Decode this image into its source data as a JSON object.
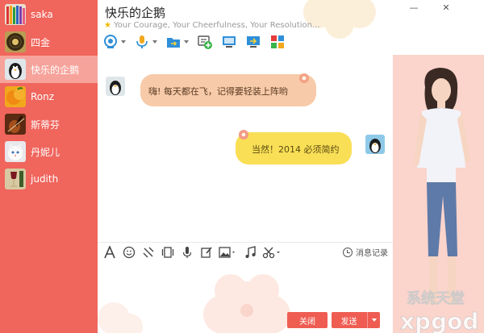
{
  "contacts": [
    {
      "name": "saka",
      "icon": "pencils-avatar",
      "active": false
    },
    {
      "name": "四金",
      "icon": "vinyl-record-avatar",
      "active": false
    },
    {
      "name": "快乐的企鹅",
      "icon": "penguin-avatar",
      "active": true
    },
    {
      "name": "Ronz",
      "icon": "orange-avatar",
      "active": false
    },
    {
      "name": "斯蒂芬",
      "icon": "violin-avatar",
      "active": false
    },
    {
      "name": "丹妮儿",
      "icon": "kitten-avatar",
      "active": false
    },
    {
      "name": "judith",
      "icon": "wine-avatar",
      "active": false
    }
  ],
  "chat": {
    "title": "快乐的企鹅",
    "signature": "Your Courage, Your Cheerfulness, Your Resolution..."
  },
  "toolbar": [
    "video-call-icon",
    "voice-call-icon",
    "file-transfer-icon",
    "add-member-icon",
    "remote-desktop-icon",
    "screen-share-icon",
    "apps-grid-icon"
  ],
  "messages": [
    {
      "side": "left",
      "text": "嗨! 每天都在飞，记得要轻装上阵哟"
    },
    {
      "side": "right",
      "text": "当然！2014 必须简约"
    }
  ],
  "input_toolbar": [
    "font-icon",
    "emoji-icon",
    "shake-icon",
    "gif-icon",
    "voice-message-icon",
    "edit-icon",
    "image-icon",
    "music-icon",
    "scissors-icon"
  ],
  "history_label": "消息记录",
  "buttons": {
    "close": "关闭",
    "send": "发送"
  },
  "window_controls": {
    "minimize": "—",
    "close": "✕"
  },
  "watermark": {
    "cn": "系统天堂",
    "en": "xpgod"
  },
  "colors": {
    "accent": "#ef5d52",
    "sidebar": "#f0655c",
    "left_bubble": "#f7caa9",
    "right_bubble": "#f9df56"
  }
}
